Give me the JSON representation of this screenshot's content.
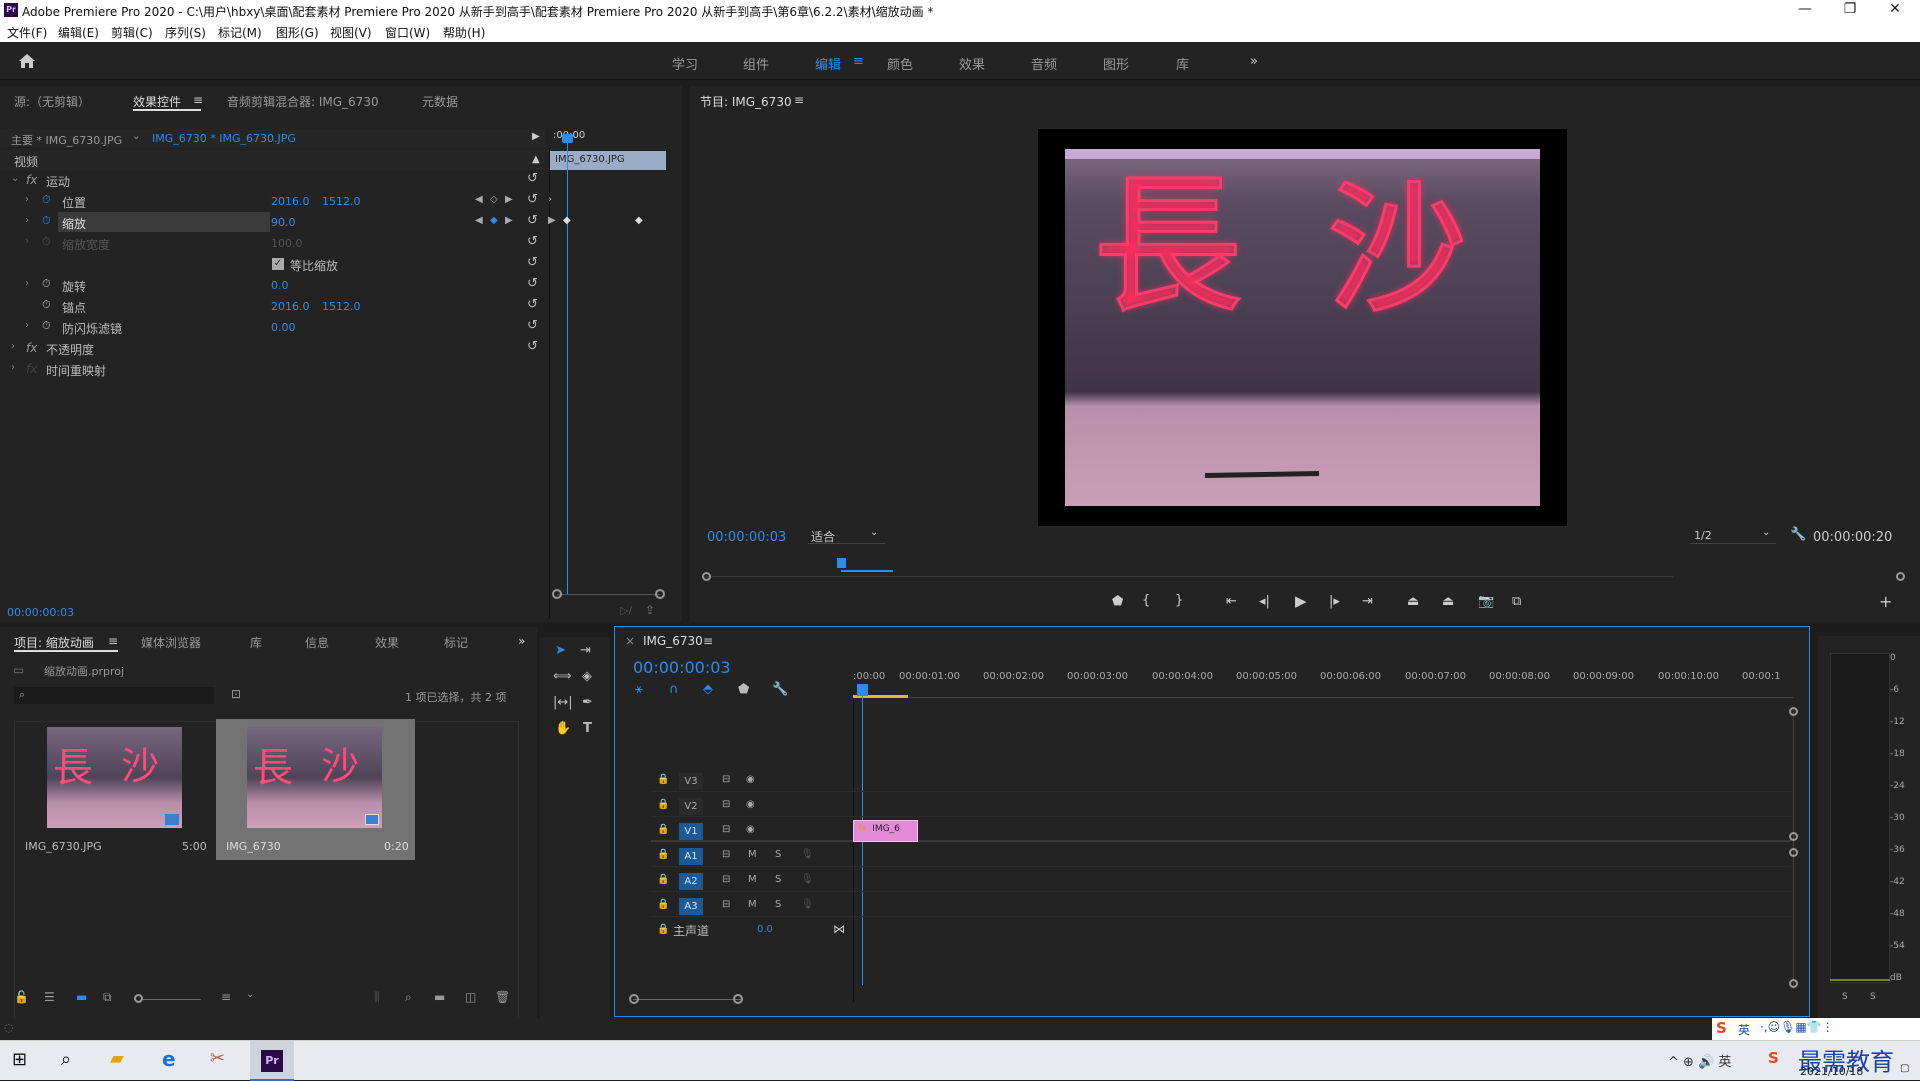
{
  "window": {
    "app_icon": "Pr",
    "title": "Adobe Premiere Pro 2020 - C:\\用户\\hbxy\\桌面\\配套素材 Premiere Pro 2020 从新手到高手\\配套素材 Premiere Pro 2020 从新手到高手\\第6章\\6.2.2\\素材\\缩放动画 *"
  },
  "menu": [
    "文件(F)",
    "编辑(E)",
    "剪辑(C)",
    "序列(S)",
    "标记(M)",
    "图形(G)",
    "视图(V)",
    "窗口(W)",
    "帮助(H)"
  ],
  "workspaces": [
    "学习",
    "组件",
    "编辑",
    "颜色",
    "效果",
    "音频",
    "图形",
    "库"
  ],
  "workspace_more": "»",
  "left_tabs": [
    "源:（无剪辑）",
    "效果控件",
    "音频剪辑混合器: IMG_6730",
    "元数据"
  ],
  "effect_controls": {
    "master": "主要 * IMG_6730.JPG",
    "clip": "IMG_6730 * IMG_6730.JPG",
    "ruler_time": ":00:00",
    "clip_bar": "IMG_6730.JPG",
    "section_video": "视频",
    "motion": "运动",
    "fx": "fx",
    "props": {
      "position": {
        "label": "位置",
        "x": "2016.0",
        "y": "1512.0"
      },
      "scale": {
        "label": "缩放",
        "value": "90.0"
      },
      "scale_width": {
        "label": "缩放宽度",
        "value": "100.0"
      },
      "uniform": {
        "label": "等比缩放"
      },
      "rotation": {
        "label": "旋转",
        "value": "0.0"
      },
      "anchor": {
        "label": "锚点",
        "x": "2016.0",
        "y": "1512.0"
      },
      "flicker": {
        "label": "防闪烁滤镜",
        "value": "0.00"
      }
    },
    "opacity": "不透明度",
    "time_remap": "时间重映射",
    "current_time": "00:00:00:03"
  },
  "program": {
    "tab": "节目: IMG_6730",
    "timecode": "00:00:00:03",
    "fit": "适合",
    "resolution": "1/2",
    "duration": "00:00:00:20",
    "image_text": [
      "長",
      "沙"
    ],
    "playhead_progress": 0.14
  },
  "project": {
    "tabs": [
      "项目: 缩放动画",
      "媒体浏览器",
      "库",
      "信息",
      "效果",
      "标记"
    ],
    "file": "缩放动画.prproj",
    "selection_status": "1 项已选择，共 2 项",
    "items": [
      {
        "name": "IMG_6730.JPG",
        "duration": "5:00"
      },
      {
        "name": "IMG_6730",
        "duration": "0:20"
      }
    ]
  },
  "timeline": {
    "tab": "IMG_6730",
    "timecode": "00:00:00:03",
    "ruler": [
      ":00:00",
      "00:00:01:00",
      "00:00:02:00",
      "00:00:03:00",
      "00:00:04:00",
      "00:00:05:00",
      "00:00:06:00",
      "00:00:07:00",
      "00:00:08:00",
      "00:00:09:00",
      "00:00:10:00",
      "00:00:1"
    ],
    "video_tracks": [
      "V3",
      "V2",
      "V1"
    ],
    "audio_tracks": [
      "A1",
      "A2",
      "A3"
    ],
    "master": "主声道",
    "master_value": "0.0",
    "clip": "IMG_6",
    "mute": "M",
    "solo": "S"
  },
  "meter": {
    "scale": [
      "0",
      "-6",
      "-12",
      "-18",
      "-24",
      "-30",
      "-36",
      "-42",
      "-48",
      "-54",
      "dB"
    ],
    "solo": [
      "S",
      "S"
    ]
  },
  "taskbar": {
    "ime": "英",
    "watermark": "最需教育",
    "date": "2021/10/18"
  },
  "colors": {
    "accent": "#2d8ceb",
    "clip": "#e38ad6",
    "panel": "#232323",
    "bg": "#1d1d1d"
  }
}
